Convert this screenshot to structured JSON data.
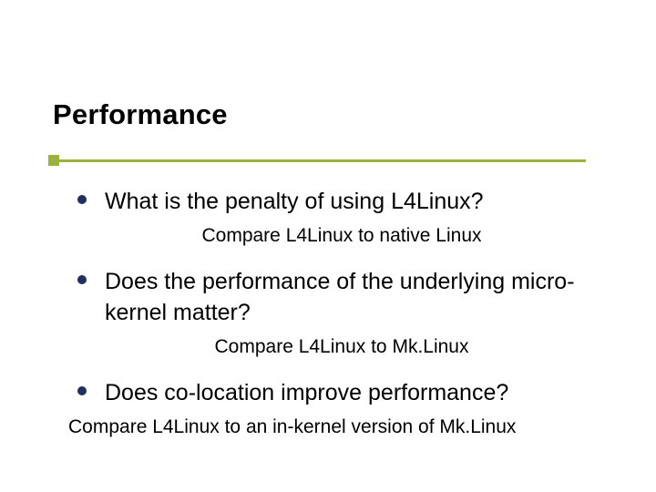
{
  "title": "Performance",
  "bullets": [
    {
      "question": "What is the penalty of using L4Linux?",
      "sub": "Compare L4Linux to native Linux"
    },
    {
      "question": "Does the performance of the underlying micro-kernel matter?",
      "sub": "Compare L4Linux to Mk.Linux"
    },
    {
      "question": "Does co-location improve performance?",
      "sub": "Compare L4Linux to an in-kernel version of Mk.Linux"
    }
  ]
}
